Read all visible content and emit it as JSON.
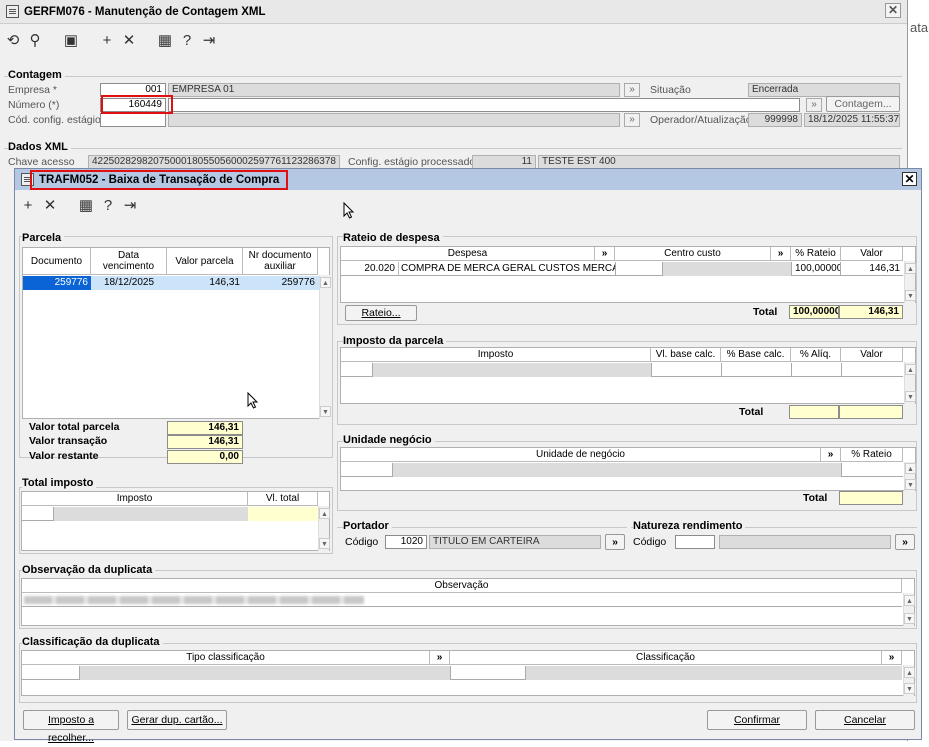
{
  "bg_window": {
    "title": "GERFM076 - Manutenção de Contagem XML",
    "side_text": "ata",
    "contagem": {
      "legend": "Contagem",
      "empresa_label": "Empresa *",
      "empresa_code": "001",
      "empresa_name": "EMPRESA 01",
      "numero_label": "Número (*)",
      "numero_value": "160449",
      "cod_label": "Cód. config. estágio",
      "situacao_label": "Situação",
      "situacao_value": "Encerrada",
      "contagem_button": "Contagem...",
      "operador_label": "Operador/Atualização",
      "operador_value": "999998",
      "operador_date": "18/12/2025 11:55:37"
    },
    "dados": {
      "legend": "Dados XML",
      "chave_label": "Chave acesso",
      "chave_value": "42250282982075000180550560002597761123286378",
      "config_label": "Config. estágio processado",
      "config_code": "11",
      "config_name": "TESTE EST 400"
    }
  },
  "dialog": {
    "title": "TRAFM052 - Baixa de Transação de Compra",
    "parcela": {
      "legend": "Parcela",
      "headers": [
        "Documento",
        "Data vencimento",
        "Valor parcela",
        "Nr documento auxiliar"
      ],
      "row": [
        "259776",
        "18/12/2025",
        "146,31",
        "259776"
      ],
      "totals": [
        {
          "label": "Valor total parcela",
          "value": "146,31"
        },
        {
          "label": "Valor transação",
          "value": "146,31"
        },
        {
          "label": "Valor restante",
          "value": "0,00"
        }
      ]
    },
    "total_imposto": {
      "legend": "Total imposto",
      "headers": [
        "Imposto",
        "Vl. total"
      ]
    },
    "rateio": {
      "legend": "Rateio de despesa",
      "headers": [
        "Despesa",
        "»",
        "Centro custo",
        "»",
        "% Rateio",
        "Valor"
      ],
      "row": {
        "code": "20.020",
        "name": "COMPRA DE MERCA GERAL CUSTOS MERCADO",
        "pct": "100,00000",
        "valor": "146,31"
      },
      "button": "Rateio...",
      "total_label": "Total",
      "total_pct": "100,00000",
      "total_valor": "146,31"
    },
    "imposto_parcela": {
      "legend": "Imposto da parcela",
      "headers": [
        "Imposto",
        "Vl. base calc.",
        "% Base calc.",
        "% Alíq.",
        "Valor"
      ],
      "total_label": "Total"
    },
    "unidade": {
      "legend": "Unidade negócio",
      "headers": [
        "Unidade de negócio",
        "»",
        "% Rateio"
      ],
      "total_label": "Total"
    },
    "portador": {
      "legend": "Portador",
      "codigo_label": "Código",
      "codigo": "1020",
      "nome": "TITULO EM CARTEIRA",
      "btn": "»"
    },
    "natureza": {
      "legend": "Natureza rendimento",
      "codigo_label": "Código",
      "btn": "»"
    },
    "observacao": {
      "legend": "Observação da duplicata",
      "header": "Observação"
    },
    "classificacao": {
      "legend": "Classificação da duplicata",
      "headers": [
        "Tipo classificação",
        "»",
        "Classificação",
        "»"
      ]
    },
    "buttons": {
      "imposto": "Imposto a recolher...",
      "gerar": "Gerar dup. cartão...",
      "confirmar": "Confirmar",
      "cancelar": "Cancelar"
    }
  },
  "colors": {
    "title_bg": "#b4c8e4",
    "highlight": "#e01010",
    "selection": "#0a64d6",
    "yellow": "#ffffd0"
  }
}
